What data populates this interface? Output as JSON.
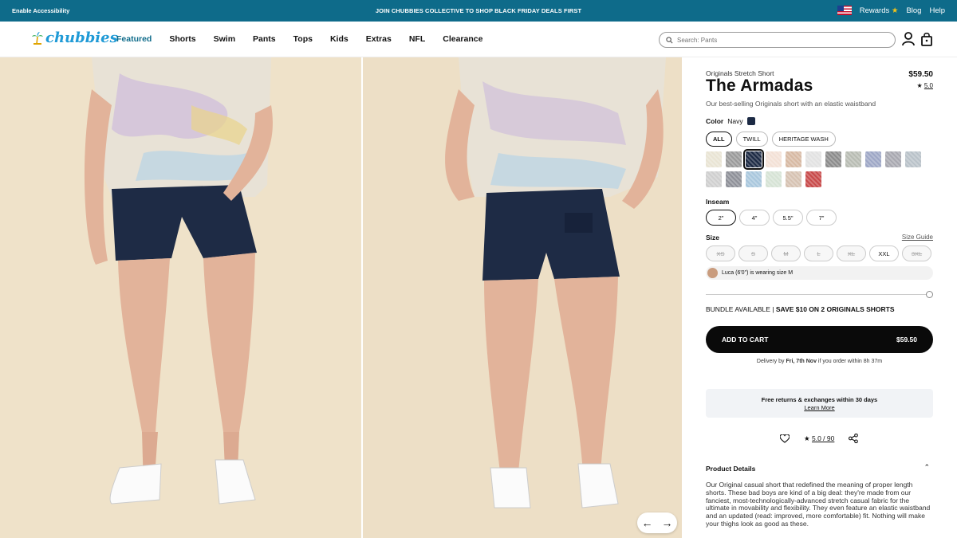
{
  "topbar": {
    "accessibility": "Enable Accessibility",
    "promo": "JOIN CHUBBIES COLLECTIVE TO SHOP BLACK FRIDAY DEALS FIRST",
    "rewards": "Rewards",
    "blog": "Blog",
    "help": "Help"
  },
  "header": {
    "logo": "chubbies",
    "nav": [
      "Featured",
      "Shorts",
      "Swim",
      "Pants",
      "Tops",
      "Kids",
      "Extras",
      "NFL",
      "Clearance"
    ],
    "search_placeholder": "Search: Pants"
  },
  "product": {
    "subtitle": "Originals Stretch Short",
    "price": "$59.50",
    "title": "The Armadas",
    "rating": "5.0",
    "description": "Our best-selling Originals short with an elastic waistband",
    "color_label": "Color",
    "color_value": "Navy",
    "color_color": "#1c2a44",
    "filters": [
      "ALL",
      "TWILL",
      "HERITAGE WASH"
    ],
    "swatch_colors": [
      "#e9e4d4",
      "#9a9a9a",
      "#1c2a44",
      "#f3e1d6",
      "#d7b9a3",
      "#e2e2e2",
      "#8b8b8b",
      "#b8bcb3",
      "#9ea7c6",
      "#a8a8b0",
      "#b9c2c9",
      "#cfcfcf",
      "#8e9098",
      "#a9c7dd",
      "#d6e3d5",
      "#d6c2b2",
      "#c84a4a"
    ],
    "inseam_label": "Inseam",
    "inseams": [
      "2\"",
      "4\"",
      "5.5\"",
      "7\""
    ],
    "size_label": "Size",
    "size_guide": "Size Guide",
    "sizes": [
      "XS",
      "S",
      "M",
      "L",
      "XL",
      "XXL",
      "3XL"
    ],
    "model_note": "Luca (6'0\") is wearing size M",
    "bundle_prefix": "BUNDLE AVAILABLE | ",
    "bundle_text": "SAVE $10 ON 2 ORIGINALS SHORTS",
    "cart_label": "ADD TO CART",
    "cart_price": "$59.50",
    "delivery_prefix": "Delivery by ",
    "delivery_date": "Fri, 7th Nov",
    "delivery_suffix": " if you order within 8h 37m",
    "returns": "Free returns & exchanges within 30 days",
    "learn_more": "Learn More",
    "reviews": "5.0 / 90",
    "details_title": "Product Details",
    "details_text": "Our Original casual short that redefined the meaning of proper length shorts. These bad boys are kind of a big deal: they're made from our fanciest, most-technologically-advanced stretch casual fabric for the ultimate in movability and flexibility. They even feature an elastic waistband and an updated (read: improved, more comfortable) fit. Nothing will make your thighs look as good as these."
  }
}
